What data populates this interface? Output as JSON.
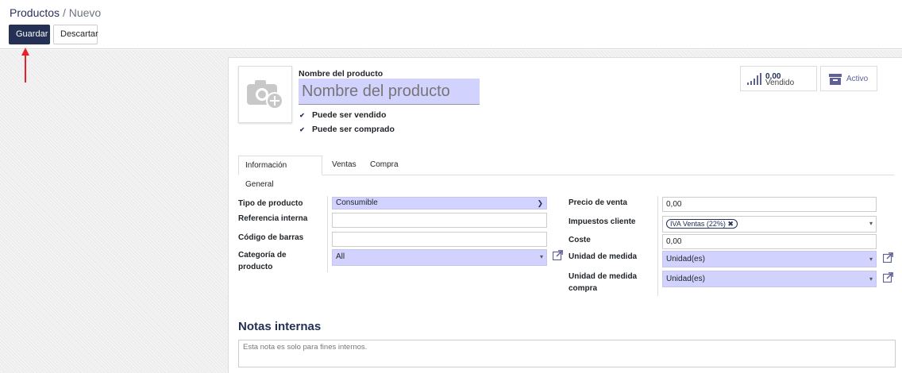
{
  "breadcrumb": {
    "parent": "Productos",
    "separator": "/",
    "current": "Nuevo"
  },
  "toolbar": {
    "save_label": "Guardar",
    "discard_label": "Descartar"
  },
  "colors": {
    "primary": "#243054",
    "required_field": "#d2d2ff",
    "annotation_arrow": "#e8202a"
  },
  "product": {
    "name_label": "Nombre del producto",
    "name_placeholder": "Nombre del producto",
    "can_be_sold": "Puede ser vendido",
    "can_be_purchased": "Puede ser comprado"
  },
  "stats": {
    "sold_value": "0,00",
    "sold_label": "Vendido",
    "active_label": "Activo",
    "sold_icon": "bar-chart-icon",
    "active_icon": "archive-icon"
  },
  "tabs": [
    {
      "label": "Información General",
      "active": true
    },
    {
      "label": "Ventas",
      "active": false
    },
    {
      "label": "Compra",
      "active": false
    }
  ],
  "left_fields": {
    "product_type": {
      "label": "Tipo de producto",
      "value": "Consumible"
    },
    "internal_ref": {
      "label": "Referencia interna",
      "value": ""
    },
    "barcode": {
      "label": "Código de barras",
      "value": ""
    },
    "category": {
      "label": "Categoría de producto",
      "value": "All"
    }
  },
  "right_fields": {
    "sale_price": {
      "label": "Precio de venta",
      "value": "0,00"
    },
    "customer_taxes": {
      "label": "Impuestos cliente",
      "tag": "IVA Ventas (22%)"
    },
    "cost": {
      "label": "Coste",
      "value": "0,00"
    },
    "uom": {
      "label": "Unidad de medida",
      "value": "Unidad(es)"
    },
    "uom_purchase": {
      "label": "Unidad de medida compra",
      "value": "Unidad(es)"
    }
  },
  "notes": {
    "title": "Notas internas",
    "placeholder": "Esta nota es solo para fines internos."
  }
}
